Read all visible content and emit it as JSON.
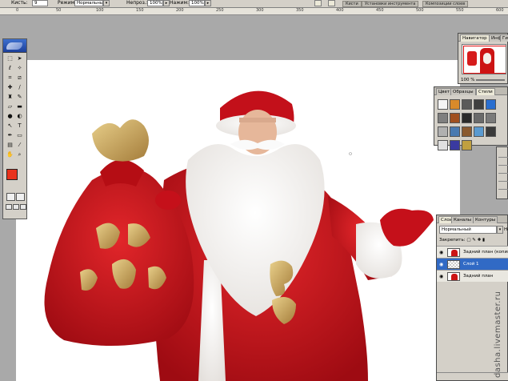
{
  "options_bar": {
    "brush_label": "Кисть:",
    "brush_size": "9",
    "mode_label": "Режим:",
    "mode_value": "Нормальный",
    "opacity_label": "Непроз.:",
    "opacity_value": "100%",
    "flow_label": "Нажим:",
    "flow_value": "100%",
    "well_tabs": [
      "Кисти",
      "Установки инструмента",
      "Композиции слоев"
    ]
  },
  "ruler": {
    "ticks": [
      "0",
      "50",
      "100",
      "150",
      "200",
      "250",
      "300",
      "350",
      "400",
      "450",
      "500",
      "550",
      "600"
    ]
  },
  "toolbox": {
    "tools": [
      "marquee-icon",
      "move-icon",
      "lasso-icon",
      "magic-wand-icon",
      "crop-icon",
      "slice-icon",
      "healing-icon",
      "brush-icon",
      "stamp-icon",
      "history-brush-icon",
      "eraser-icon",
      "gradient-icon",
      "blur-icon",
      "dodge-icon",
      "path-select-icon",
      "type-icon",
      "pen-icon",
      "shape-icon",
      "notes-icon",
      "eyedropper-icon",
      "hand-icon",
      "zoom-icon"
    ],
    "tool_glyphs": [
      "⬚",
      "➤",
      "ℓ",
      "✧",
      "⌗",
      "⧄",
      "✚",
      "∕",
      "♜",
      "✎",
      "▱",
      "▬",
      "●",
      "◐",
      "↖",
      "T",
      "✒",
      "▭",
      "▤",
      "⁄",
      "✋",
      "⌕"
    ],
    "foreground_color": "#e8331d",
    "background_color": "#ffffff"
  },
  "navigator": {
    "tabs": [
      "Навигатор",
      "Инфо",
      "Гис"
    ],
    "zoom": "100 %"
  },
  "styles_palette": {
    "tabs": [
      "Цвет",
      "Образцы",
      "Стили"
    ],
    "swatches": [
      "#f4f4f4",
      "#d88a2a",
      "#5a5a5a",
      "#3f3f3f",
      "#2a6fd0",
      "#7f7f7f",
      "#a05020",
      "#2a2a2a",
      "#6a6a6a",
      "#7a7a7a",
      "#b0b0b0",
      "#4a7ab0",
      "#8a5a30",
      "#5a9ad0",
      "#3a3a3a",
      "#e0e0e0",
      "#3a3aa0",
      "#c0a040"
    ]
  },
  "layers_panel": {
    "tabs": [
      "Слои",
      "Каналы",
      "Контуры"
    ],
    "blend_mode": "Нормальный",
    "opacity_short": "Не",
    "lock_label": "Закрепить:",
    "layers": [
      {
        "name": "Задний план (копия)",
        "selected": false
      },
      {
        "name": "Слой 1",
        "selected": true
      },
      {
        "name": "Задний план",
        "selected": false
      }
    ]
  },
  "watermark": "dasha.livemaster.ru"
}
